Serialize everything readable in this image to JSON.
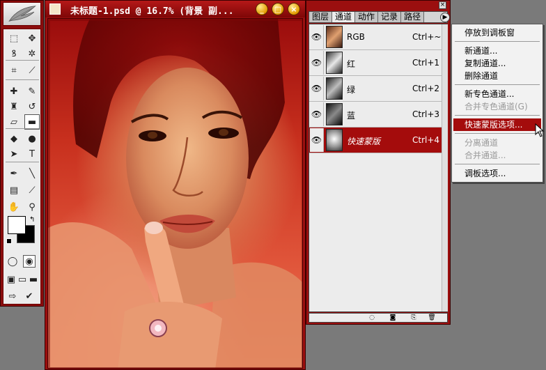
{
  "document": {
    "title": "未标题-1.psd @ 16.7% (背景 副...",
    "buttons": {
      "minimize": "_",
      "maximize": "□",
      "close": "×"
    }
  },
  "toolbox": {
    "tools": [
      {
        "name": "marquee-tool",
        "glyph": "⬚"
      },
      {
        "name": "move-tool",
        "glyph": "✥"
      },
      {
        "name": "lasso-tool",
        "glyph": "ꝸ"
      },
      {
        "name": "magic-wand-tool",
        "glyph": "✲"
      },
      {
        "name": "crop-tool",
        "glyph": "⌗"
      },
      {
        "name": "eyedropper-slice-tool",
        "glyph": "⟋"
      },
      {
        "name": "healing-brush-tool",
        "glyph": "✚"
      },
      {
        "name": "brush-tool",
        "glyph": "✎"
      },
      {
        "name": "clone-stamp-tool",
        "glyph": "♜"
      },
      {
        "name": "history-brush-tool",
        "glyph": "↺"
      },
      {
        "name": "eraser-tool",
        "glyph": "▱"
      },
      {
        "name": "gradient-tool",
        "glyph": "▬"
      },
      {
        "name": "blur-tool",
        "glyph": "◆"
      },
      {
        "name": "dodge-tool",
        "glyph": "●"
      },
      {
        "name": "path-selection-tool",
        "glyph": "➤"
      },
      {
        "name": "type-tool",
        "glyph": "T"
      },
      {
        "name": "pen-tool",
        "glyph": "✒"
      },
      {
        "name": "line-tool",
        "glyph": "╲"
      },
      {
        "name": "notes-tool",
        "glyph": "▤"
      },
      {
        "name": "eyedropper-tool",
        "glyph": "⟋"
      },
      {
        "name": "hand-tool",
        "glyph": "✋"
      },
      {
        "name": "zoom-tool",
        "glyph": "⚲"
      }
    ],
    "selected_tool": "gradient-tool",
    "foreground_color": "#ffffff",
    "background_color": "#000000"
  },
  "channels_panel": {
    "tabs": [
      {
        "label": "图层",
        "active": false
      },
      {
        "label": "通道",
        "active": true
      },
      {
        "label": "动作",
        "active": false
      },
      {
        "label": "记录",
        "active": false
      },
      {
        "label": "路径",
        "active": false
      }
    ],
    "channels": [
      {
        "name": "RGB",
        "shortcut": "Ctrl+~",
        "selected": false
      },
      {
        "name": "红",
        "shortcut": "Ctrl+1",
        "selected": false
      },
      {
        "name": "绿",
        "shortcut": "Ctrl+2",
        "selected": false
      },
      {
        "name": "蓝",
        "shortcut": "Ctrl+3",
        "selected": false
      },
      {
        "name": "快速蒙版",
        "shortcut": "Ctrl+4",
        "selected": true
      }
    ],
    "footer_buttons": [
      "load-selection-icon",
      "save-selection-icon",
      "new-channel-icon",
      "delete-channel-icon"
    ]
  },
  "flyout_menu": {
    "items": [
      {
        "label": "停放到调板窗",
        "enabled": true,
        "highlighted": false
      },
      {
        "separator": true
      },
      {
        "label": "新通道...",
        "enabled": true,
        "highlighted": false
      },
      {
        "label": "复制通道...",
        "enabled": true,
        "highlighted": false
      },
      {
        "label": "删除通道",
        "enabled": true,
        "highlighted": false
      },
      {
        "separator": true
      },
      {
        "label": "新专色通道...",
        "enabled": true,
        "highlighted": false
      },
      {
        "label": "合并专色通道(G)",
        "enabled": false,
        "highlighted": false
      },
      {
        "separator": true
      },
      {
        "label": "快速蒙版选项...",
        "enabled": true,
        "highlighted": true
      },
      {
        "separator": true
      },
      {
        "label": "分离通道",
        "enabled": false,
        "highlighted": false
      },
      {
        "label": "合并通道...",
        "enabled": false,
        "highlighted": false
      },
      {
        "separator": true
      },
      {
        "label": "调板选项...",
        "enabled": true,
        "highlighted": false
      }
    ]
  },
  "colors": {
    "window_frame": "#9b0f0f",
    "highlight": "#a40c0c",
    "desktop": "#7a7a7a"
  }
}
